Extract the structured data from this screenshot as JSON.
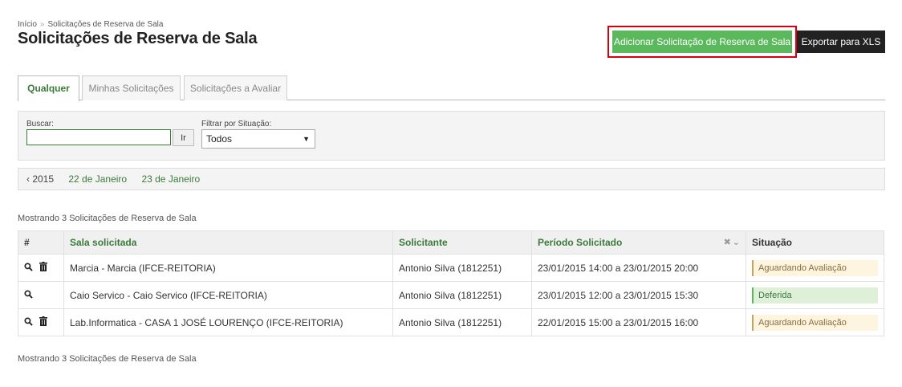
{
  "breadcrumb": {
    "home": "Início",
    "current": "Solicitações de Reserva de Sala"
  },
  "page_title": "Solicitações de Reserva de Sala",
  "actions": {
    "add_label": "Adicionar Solicitação de Reserva de Sala",
    "export_label": "Exportar para XLS"
  },
  "tabs": [
    {
      "label": "Qualquer"
    },
    {
      "label": "Minhas Solicitações"
    },
    {
      "label": "Solicitações a Avaliar"
    }
  ],
  "filters": {
    "search_label": "Buscar:",
    "search_value": "",
    "go_label": "Ir",
    "status_label": "Filtrar por Situação:",
    "status_selected": "Todos"
  },
  "date_nav": {
    "year": "‹ 2015",
    "day1": "22 de Janeiro",
    "day2": "23 de Janeiro"
  },
  "summary_text": "Mostrando 3 Solicitações de Reserva de Sala",
  "table": {
    "headers": {
      "num": "#",
      "sala": "Sala solicitada",
      "solicitante": "Solicitante",
      "periodo": "Período Solicitado",
      "situacao": "Situação"
    },
    "rows": [
      {
        "sala": "Marcia - Marcia (IFCE-REITORIA)",
        "solicitante": "Antonio Silva (1812251)",
        "periodo": "23/01/2015 14:00 a 23/01/2015 20:00",
        "situacao": "Aguardando Avaliação"
      },
      {
        "sala": "Caio Servico - Caio Servico (IFCE-REITORIA)",
        "solicitante": "Antonio Silva (1812251)",
        "periodo": "23/01/2015 12:00 a 23/01/2015 15:30",
        "situacao": "Deferida"
      },
      {
        "sala": "Lab.Informatica - CASA 1 JOSÉ LOURENÇO (IFCE-REITORIA)",
        "solicitante": "Antonio Silva (1812251)",
        "periodo": "22/01/2015 15:00 a 23/01/2015 16:00",
        "situacao": "Aguardando Avaliação"
      }
    ]
  },
  "icons": {
    "view": "search-icon",
    "delete": "trash-icon",
    "clear_sort": "close-icon",
    "sort": "chevron-down-icon"
  },
  "colors": {
    "accent_green": "#5cb85c",
    "highlight_red": "#d9000d",
    "link_green": "#3a7a3a"
  }
}
